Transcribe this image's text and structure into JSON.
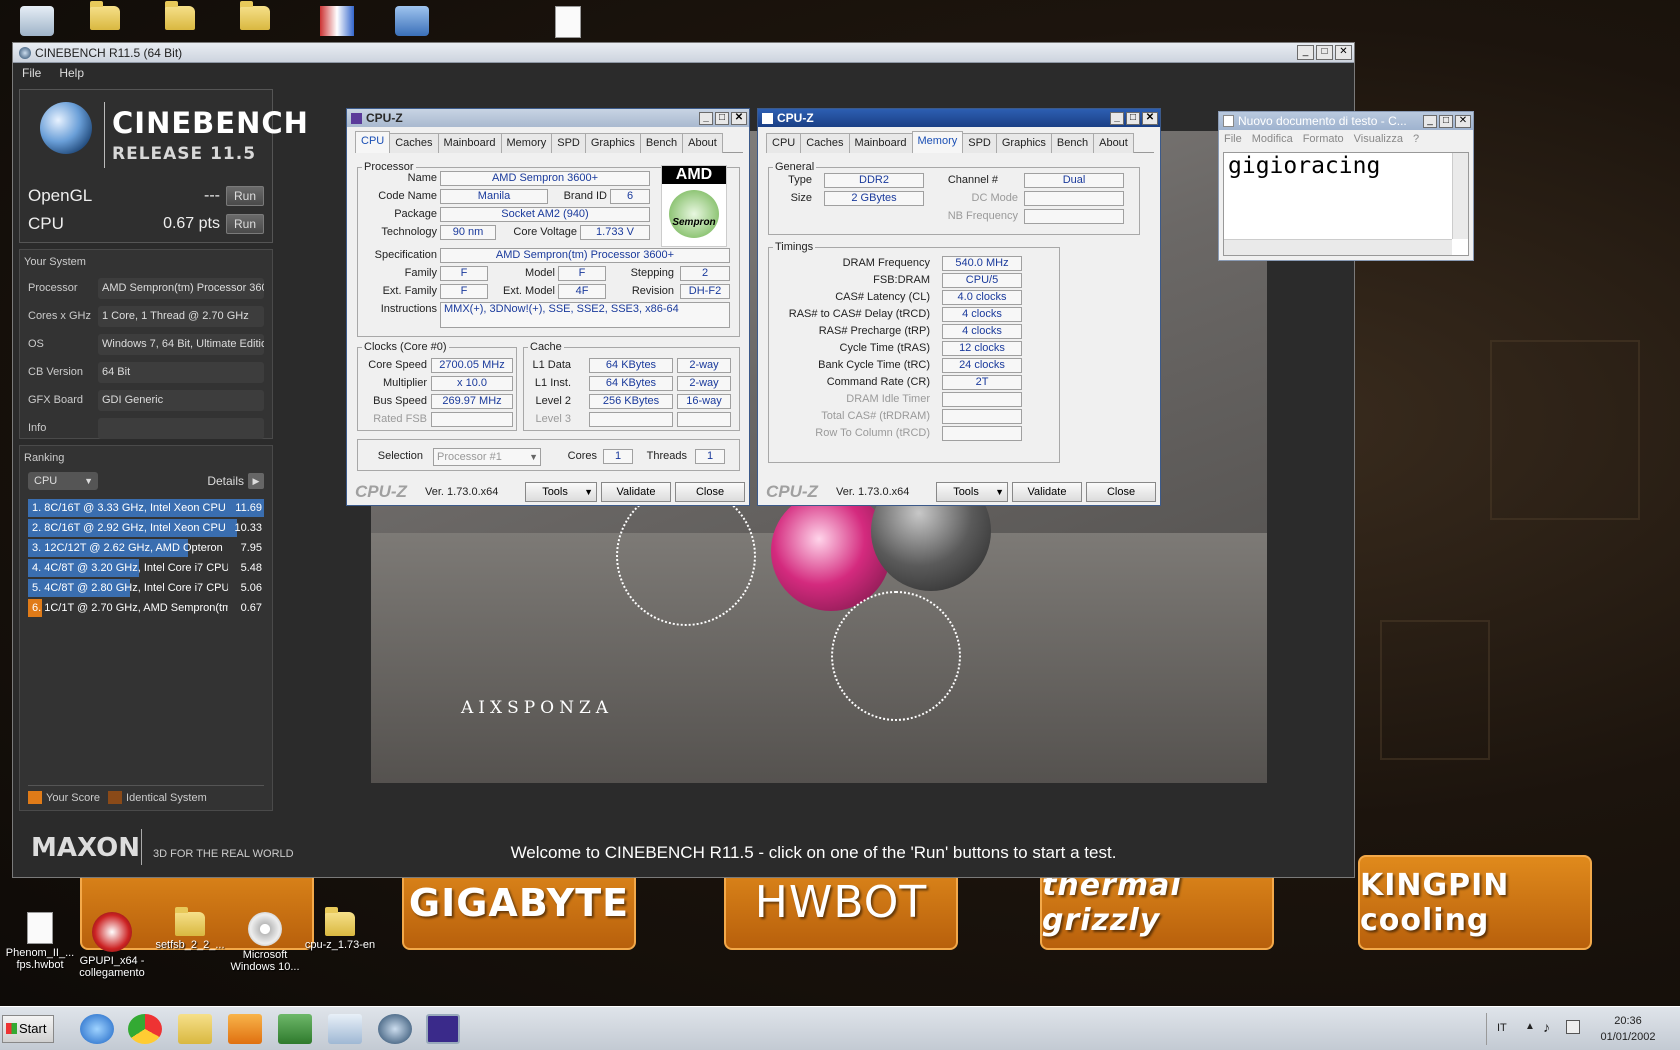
{
  "desktop": {
    "icons": [
      {
        "label": "Phenom_II_... fps.hwbot"
      },
      {
        "label": "GPUPI_x64 - collegamento"
      },
      {
        "label": "setfsb_2_2_..."
      },
      {
        "label": "Microsoft Windows 10..."
      },
      {
        "label": "cpu-z_1.73-en"
      }
    ],
    "sponsors": [
      "GIGABYTE",
      "HWBOT",
      "thermal grizzly",
      "KINGPIN cooling"
    ]
  },
  "cinebench": {
    "title": "CINEBENCH R11.5 (64 Bit)",
    "menu": [
      "File",
      "Help"
    ],
    "logo_title": "CINEBENCH",
    "logo_sub": "RELEASE 11.5",
    "opengl": {
      "label": "OpenGL",
      "value": "---",
      "run": "Run"
    },
    "cpu": {
      "label": "CPU",
      "value": "0.67 pts",
      "run": "Run"
    },
    "your_system_title": "Your System",
    "system": [
      {
        "key": "Processor",
        "value": "AMD Sempron(tm) Processor 360("
      },
      {
        "key": "Cores x GHz",
        "value": "1 Core, 1 Thread @ 2.70 GHz"
      },
      {
        "key": "OS",
        "value": "Windows 7, 64 Bit, Ultimate Editio"
      },
      {
        "key": "CB Version",
        "value": "64 Bit"
      },
      {
        "key": "GFX Board",
        "value": "GDI Generic"
      },
      {
        "key": "Info",
        "value": ""
      }
    ],
    "ranking_title": "Ranking",
    "ranking_select": "CPU",
    "details_label": "Details",
    "ranking": [
      {
        "name": "1. 8C/16T @ 3.33 GHz, Intel Xeon CPU",
        "score": "11.69",
        "fill": 1.0,
        "own": false
      },
      {
        "name": "2. 8C/16T @ 2.92 GHz, Intel Xeon CPU",
        "score": "10.33",
        "fill": 0.884,
        "own": false
      },
      {
        "name": "3. 12C/12T @ 2.62 GHz, AMD Opteron",
        "score": "7.95",
        "fill": 0.68,
        "own": false
      },
      {
        "name": "4. 4C/8T @ 3.20 GHz, Intel Core i7 CPU",
        "score": "5.48",
        "fill": 0.469,
        "own": false
      },
      {
        "name": "5. 4C/8T @ 2.80 GHz, Intel Core i7 CPU",
        "score": "5.06",
        "fill": 0.433,
        "own": false
      },
      {
        "name": "6. 1C/1T @ 2.70 GHz, AMD Sempron(tm",
        "score": "0.67",
        "fill": 0.06,
        "own": true
      }
    ],
    "legend_your_score": "Your Score",
    "legend_identical": "Identical System",
    "maxon": "MAXON",
    "maxon_sub": "3D FOR THE REAL WORLD",
    "welcome": "Welcome to CINEBENCH R11.5 - click on one of the 'Run' buttons to start a test.",
    "render_watermark": "AIXSPONZA"
  },
  "cpuz_cpu": {
    "title": "CPU-Z",
    "tabs": [
      "CPU",
      "Caches",
      "Mainboard",
      "Memory",
      "SPD",
      "Graphics",
      "Bench",
      "About"
    ],
    "selected_tab": "CPU",
    "processor_legend": "Processor",
    "name_label": "Name",
    "name": "AMD Sempron 3600+",
    "codename_label": "Code Name",
    "codename": "Manila",
    "brandid_label": "Brand ID",
    "brandid": "6",
    "package_label": "Package",
    "package": "Socket AM2 (940)",
    "technology_label": "Technology",
    "technology": "90 nm",
    "corevoltage_label": "Core Voltage",
    "corevoltage": "1.733 V",
    "spec_label": "Specification",
    "spec": "AMD Sempron(tm) Processor 3600+",
    "family_label": "Family",
    "family": "F",
    "model_label": "Model",
    "model": "F",
    "stepping_label": "Stepping",
    "stepping": "2",
    "extfamily_label": "Ext. Family",
    "extfamily": "F",
    "extmodel_label": "Ext. Model",
    "extmodel": "4F",
    "revision_label": "Revision",
    "revision": "DH-F2",
    "instructions_label": "Instructions",
    "instructions": "MMX(+), 3DNow!(+), SSE, SSE2, SSE3, x86-64",
    "logo_brand": "AMD",
    "logo_product": "Sempron",
    "clocks_legend": "Clocks (Core #0)",
    "corespeed_label": "Core Speed",
    "corespeed": "2700.05 MHz",
    "multiplier_label": "Multiplier",
    "multiplier": "x 10.0",
    "busspeed_label": "Bus Speed",
    "busspeed": "269.97 MHz",
    "ratedfsb_label": "Rated FSB",
    "cache_legend": "Cache",
    "l1data_label": "L1 Data",
    "l1data": "64 KBytes",
    "l1data_way": "2-way",
    "l1inst_label": "L1 Inst.",
    "l1inst": "64 KBytes",
    "l1inst_way": "2-way",
    "l2_label": "Level 2",
    "l2": "256 KBytes",
    "l2_way": "16-way",
    "l3_label": "Level 3",
    "selection_label": "Selection",
    "selection": "Processor #1",
    "cores_label": "Cores",
    "cores": "1",
    "threads_label": "Threads",
    "threads": "1",
    "footer_logo": "CPU-Z",
    "version": "Ver. 1.73.0.x64",
    "tools": "Tools",
    "validate": "Validate",
    "close": "Close"
  },
  "cpuz_mem": {
    "title": "CPU-Z",
    "tabs": [
      "CPU",
      "Caches",
      "Mainboard",
      "Memory",
      "SPD",
      "Graphics",
      "Bench",
      "About"
    ],
    "selected_tab": "Memory",
    "general_legend": "General",
    "type_label": "Type",
    "type": "DDR2",
    "channel_label": "Channel #",
    "channel": "Dual",
    "size_label": "Size",
    "size": "2 GBytes",
    "dcmode_label": "DC Mode",
    "nbfreq_label": "NB Frequency",
    "timings_legend": "Timings",
    "timings": [
      {
        "label": "DRAM Frequency",
        "value": "540.0 MHz",
        "dim": false
      },
      {
        "label": "FSB:DRAM",
        "value": "CPU/5",
        "dim": false
      },
      {
        "label": "CAS# Latency (CL)",
        "value": "4.0 clocks",
        "dim": false
      },
      {
        "label": "RAS# to CAS# Delay (tRCD)",
        "value": "4 clocks",
        "dim": false
      },
      {
        "label": "RAS# Precharge (tRP)",
        "value": "4 clocks",
        "dim": false
      },
      {
        "label": "Cycle Time (tRAS)",
        "value": "12 clocks",
        "dim": false
      },
      {
        "label": "Bank Cycle Time (tRC)",
        "value": "24 clocks",
        "dim": false
      },
      {
        "label": "Command Rate (CR)",
        "value": "2T",
        "dim": false
      },
      {
        "label": "DRAM Idle Timer",
        "value": "",
        "dim": true
      },
      {
        "label": "Total CAS# (tRDRAM)",
        "value": "",
        "dim": true
      },
      {
        "label": "Row To Column (tRCD)",
        "value": "",
        "dim": true
      }
    ],
    "footer_logo": "CPU-Z",
    "version": "Ver. 1.73.0.x64",
    "tools": "Tools",
    "validate": "Validate",
    "close": "Close"
  },
  "notepad": {
    "title": "Nuovo documento di testo - C...",
    "menu": [
      "File",
      "Modifica",
      "Formato",
      "Visualizza",
      "?"
    ],
    "content": "gigioracing"
  },
  "taskbar": {
    "start": "Start",
    "language": "IT",
    "time": "20:36",
    "date": "01/01/2002"
  }
}
